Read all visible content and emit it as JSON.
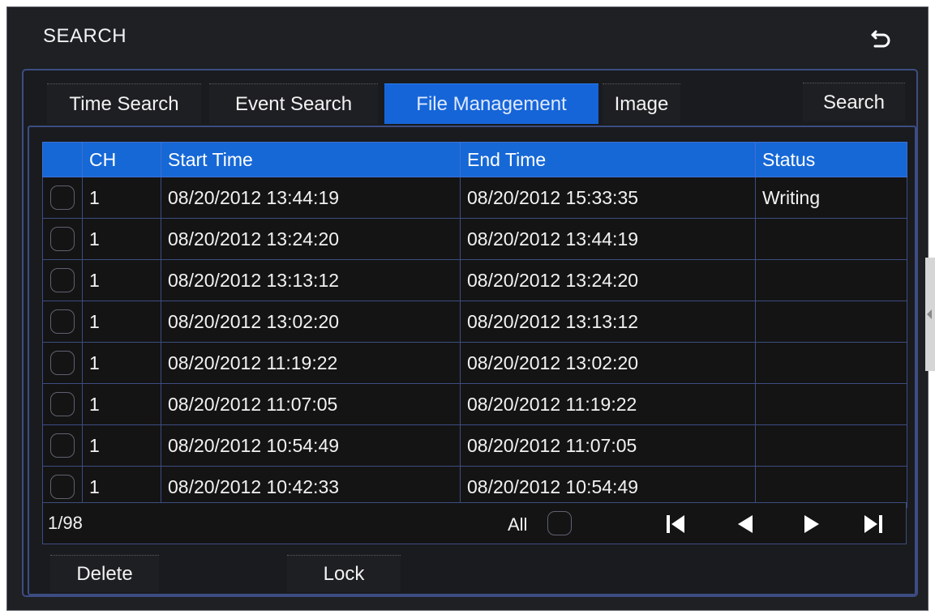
{
  "window": {
    "title": "SEARCH"
  },
  "tabs": [
    {
      "label": "Time Search",
      "active": false
    },
    {
      "label": "Event Search",
      "active": false
    },
    {
      "label": "File Management",
      "active": true
    },
    {
      "label": "Image",
      "active": false
    }
  ],
  "search_label": "Search",
  "table": {
    "columns": [
      "",
      "CH",
      "Start Time",
      "End Time",
      "Status"
    ],
    "rows": [
      {
        "ch": "1",
        "start": "08/20/2012 13:44:19",
        "end": "08/20/2012 15:33:35",
        "status": "Writing"
      },
      {
        "ch": "1",
        "start": "08/20/2012 13:24:20",
        "end": "08/20/2012 13:44:19",
        "status": ""
      },
      {
        "ch": "1",
        "start": "08/20/2012 13:13:12",
        "end": "08/20/2012 13:24:20",
        "status": ""
      },
      {
        "ch": "1",
        "start": "08/20/2012 13:02:20",
        "end": "08/20/2012 13:13:12",
        "status": ""
      },
      {
        "ch": "1",
        "start": "08/20/2012 11:19:22",
        "end": "08/20/2012 13:02:20",
        "status": ""
      },
      {
        "ch": "1",
        "start": "08/20/2012 11:07:05",
        "end": "08/20/2012 11:19:22",
        "status": ""
      },
      {
        "ch": "1",
        "start": "08/20/2012 10:54:49",
        "end": "08/20/2012 11:07:05",
        "status": ""
      },
      {
        "ch": "1",
        "start": "08/20/2012 10:42:33",
        "end": "08/20/2012 10:54:49",
        "status": ""
      }
    ]
  },
  "footer": {
    "page": "1/98",
    "all_label": "All"
  },
  "actions": {
    "delete": "Delete",
    "lock": "Lock"
  },
  "icons": {
    "back": "back-arrow-icon",
    "first": "first-page-icon",
    "prev": "previous-page-icon",
    "next": "next-page-icon",
    "last": "last-page-icon"
  },
  "colors": {
    "accent": "#1565d8",
    "border": "#3d4d82",
    "text": "#f2f2f2",
    "background": "#1e2024"
  }
}
